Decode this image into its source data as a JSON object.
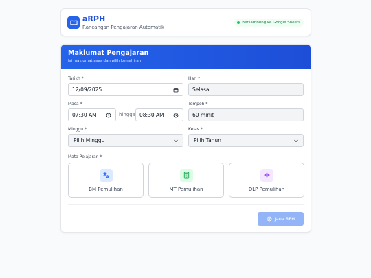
{
  "header": {
    "app_title": "aRPH",
    "app_subtitle": "Rancangan Pengajaran Automatik",
    "status": "Bersambung ke Google Sheets"
  },
  "card": {
    "title": "Maklumat Pengajaran",
    "subtitle": "Isi maklumat asas dan pilih kemahiran"
  },
  "fields": {
    "tarikh": {
      "label": "Tarikh *",
      "value": "12/09/2025"
    },
    "hari": {
      "label": "Hari *",
      "value": "Selasa"
    },
    "masa": {
      "label": "Masa *",
      "start": "07:30 AM",
      "separator": "hingga",
      "end": "08:30 AM"
    },
    "tempoh": {
      "label": "Tempoh *",
      "value": "60 minit"
    },
    "minggu": {
      "label": "Minggu *",
      "selected": "Pilih Minggu"
    },
    "kelas": {
      "label": "Kelas *",
      "selected": "Pilih Tahun"
    }
  },
  "subjects": {
    "label": "Mata Pelajaran *",
    "items": [
      {
        "name": "BM Pemulihan",
        "icon": "translate-icon",
        "color": "#2563eb",
        "bg": "#dbeafe"
      },
      {
        "name": "MT Pemulihan",
        "icon": "calculator-icon",
        "color": "#16a34a",
        "bg": "#dcfce7"
      },
      {
        "name": "DLP Pemulihan",
        "icon": "sparkle-icon",
        "color": "#9333ea",
        "bg": "#f3e8ff"
      }
    ]
  },
  "actions": {
    "generate": "Jana RPH"
  },
  "colors": {
    "primary": "#2563eb",
    "connected": "#22c55e"
  }
}
